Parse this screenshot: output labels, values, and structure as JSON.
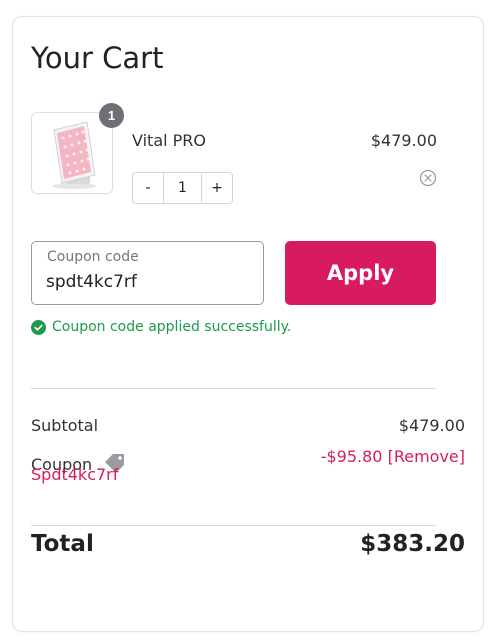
{
  "cart": {
    "title": "Your Cart",
    "item": {
      "name": "Vital PRO",
      "price": "$479.00",
      "quantity": "1",
      "badge_count": "1",
      "decrement_label": "-",
      "increment_label": "+",
      "image_icon": "red-light-panel-device",
      "remove_icon": "close-circle-icon"
    },
    "coupon": {
      "label": "Coupon code",
      "value": "spdt4kc7rf",
      "apply_label": "Apply",
      "success_message": "Coupon code applied successfully.",
      "success_icon": "check-circle-icon"
    },
    "summary": {
      "subtotal_label": "Subtotal",
      "subtotal_value": "$479.00",
      "coupon_label": "Coupon",
      "coupon_icon": "tag-icon",
      "coupon_code": "Spdt4kc7rf",
      "discount_value": "-$95.80",
      "remove_label": "[Remove]",
      "total_label": "Total",
      "total_value": "$383.20"
    },
    "colors": {
      "accent": "#d81b5e",
      "success": "#1d9a4b",
      "badge": "#6f6f77"
    }
  }
}
